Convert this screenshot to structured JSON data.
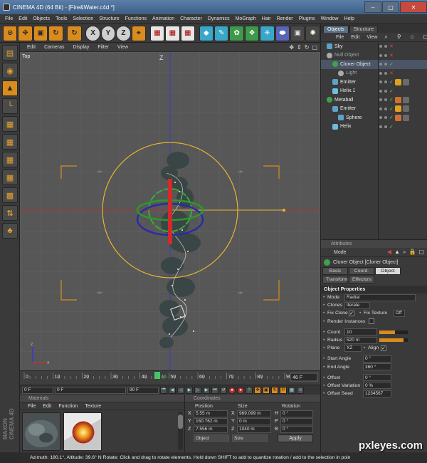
{
  "window": {
    "title": "CINEMA 4D (64 Bit) - [Fire&Water.c4d *]"
  },
  "menu": [
    "File",
    "Edit",
    "Objects",
    "Tools",
    "Selection",
    "Structure",
    "Functions",
    "Animation",
    "Character",
    "Dynamics",
    "MoGraph",
    "Hair",
    "Render",
    "Plugins",
    "Window",
    "Help"
  ],
  "toolbar": {
    "axis_x": "X",
    "axis_y": "Y",
    "axis_z": "Z"
  },
  "viewport": {
    "menu": [
      "Edit",
      "Cameras",
      "Display",
      "Filter",
      "View"
    ],
    "label": "Top",
    "axis_label": "Z"
  },
  "timeline": {
    "ticks": [
      "0",
      "10",
      "20",
      "30",
      "40",
      "50",
      "60",
      "70",
      "80",
      "90"
    ],
    "current_frame_marker": "46",
    "end_field": "46 F",
    "current_frame": "0 F",
    "min_field": "0 F",
    "max_field": "90 F",
    "current_fraction": 0.511
  },
  "materials": {
    "title": "Materials",
    "menu": [
      "File",
      "Edit",
      "Function",
      "Texture"
    ]
  },
  "coordinates": {
    "title": "Coordinates",
    "headers": [
      "Position",
      "Size",
      "Rotation"
    ],
    "rows": [
      {
        "axis": "X",
        "pos": "5.55 m",
        "size_axis": "X",
        "size": "969.099 m",
        "rot_axis": "H",
        "rot": "0 °"
      },
      {
        "axis": "Y",
        "pos": "160.762 m",
        "size_axis": "Y",
        "size": "0 m",
        "rot_axis": "P",
        "rot": "0 °"
      },
      {
        "axis": "Z",
        "pos": "7.556 m",
        "size_axis": "Z",
        "size": "1040 m",
        "rot_axis": "B",
        "rot": "0 °"
      }
    ],
    "mode_object": "Object",
    "mode_size": "Size",
    "apply": "Apply"
  },
  "status": "Azimuth: 180.1°, Altitude: 39.6°  N    Rotate: Click and drag to rotate elements. Hold down SHIFT to add to quantize rotation / add to the selection in poin",
  "objects_panel": {
    "tabs": [
      "Objects",
      "Structure"
    ],
    "menu": [
      "File",
      "Edit",
      "View"
    ],
    "items": [
      {
        "name": "Sky",
        "indent": 0,
        "icon": "sky"
      },
      {
        "name": "Null Object",
        "indent": 0,
        "icon": "null",
        "dim": true
      },
      {
        "name": "Cloner Object",
        "indent": 1,
        "icon": "cloner",
        "selected": true
      },
      {
        "name": "Light",
        "indent": 2,
        "icon": "light",
        "dim": true
      },
      {
        "name": "Emitter",
        "indent": 1,
        "icon": "emitter"
      },
      {
        "name": "Helix.1",
        "indent": 1,
        "icon": "helix"
      },
      {
        "name": "Metaball",
        "indent": 0,
        "icon": "metaball"
      },
      {
        "name": "Emitter",
        "indent": 1,
        "icon": "emitter"
      },
      {
        "name": "Sphere",
        "indent": 2,
        "icon": "sphere"
      },
      {
        "name": "Helix",
        "indent": 1,
        "icon": "helix"
      }
    ]
  },
  "attributes": {
    "title": "Attributes",
    "mode": "Mode",
    "object_name": "Cloner Object [Cloner Object]",
    "tabs": [
      "Basic",
      "Coord.",
      "Object",
      "Transform",
      "Effectors"
    ],
    "section": "Object Properties",
    "mode_row": {
      "label": "Mode",
      "value": "Radial"
    },
    "clones": {
      "label": "Clones",
      "value": "Iterate"
    },
    "fix_clone": {
      "label": "Fix Clone",
      "checked": true
    },
    "fix_texture": {
      "label": "Fix Texture",
      "value": "Off"
    },
    "render_instances": {
      "label": "Render Instances",
      "checked": false
    },
    "count": {
      "label": "Count",
      "value": "10",
      "fraction": 0.55
    },
    "radius": {
      "label": "Radius",
      "value": "520 m",
      "fraction": 0.85
    },
    "plane": {
      "label": "Plane",
      "value": "XZ"
    },
    "align": {
      "label": "Align",
      "checked": true
    },
    "start_angle": {
      "label": "Start Angle",
      "value": "0 °"
    },
    "end_angle": {
      "label": "End Angle",
      "value": "360 °"
    },
    "offset": {
      "label": "Offset",
      "value": "0 °"
    },
    "offset_variation": {
      "label": "Offset Variation",
      "value": "0 %"
    },
    "offset_seed": {
      "label": "Offset Seed",
      "value": "1234567"
    }
  },
  "watermark": "pxleyes.com",
  "colors": {
    "accent": "#d98b1e",
    "axis_x": "#c83232",
    "axis_y": "#3aa83a",
    "axis_z": "#3232c8",
    "helix": "#e6b431",
    "grid": "#5e5e5e"
  }
}
